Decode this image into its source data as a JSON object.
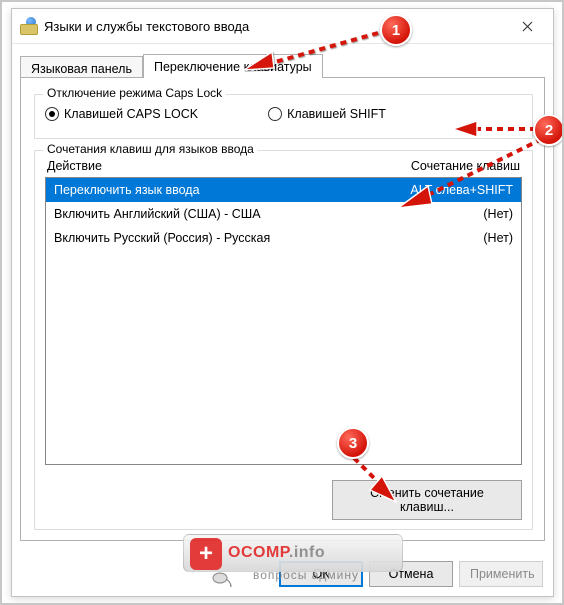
{
  "window": {
    "title": "Языки и службы текстового ввода"
  },
  "tabs": {
    "language_panel": "Языковая панель",
    "keyboard_switch": "Переключение клавиатуры"
  },
  "caps_group": {
    "legend": "Отключение режима Caps Lock",
    "opt_caps": "Клавишей CAPS LOCK",
    "opt_shift": "Клавишей SHIFT"
  },
  "hotkeys_group": {
    "legend": "Сочетания клавиш для языков ввода",
    "col_action": "Действие",
    "col_keys": "Сочетание клавиш",
    "rows": [
      {
        "action": "Переключить язык ввода",
        "keys": "ALT слева+SHIFT"
      },
      {
        "action": "Включить Английский (США) - США",
        "keys": "(Нет)"
      },
      {
        "action": "Включить Русский (Россия) - Русская",
        "keys": "(Нет)"
      }
    ],
    "change_btn": "Сменить сочетание клавиш..."
  },
  "buttons": {
    "ok": "ОК",
    "cancel": "Отмена",
    "apply": "Применить"
  },
  "annotations": {
    "b1": "1",
    "b2": "2",
    "b3": "3"
  },
  "watermark": {
    "brand": "OCOMP",
    "suffix": ".info",
    "sub": "вопросы админу"
  }
}
